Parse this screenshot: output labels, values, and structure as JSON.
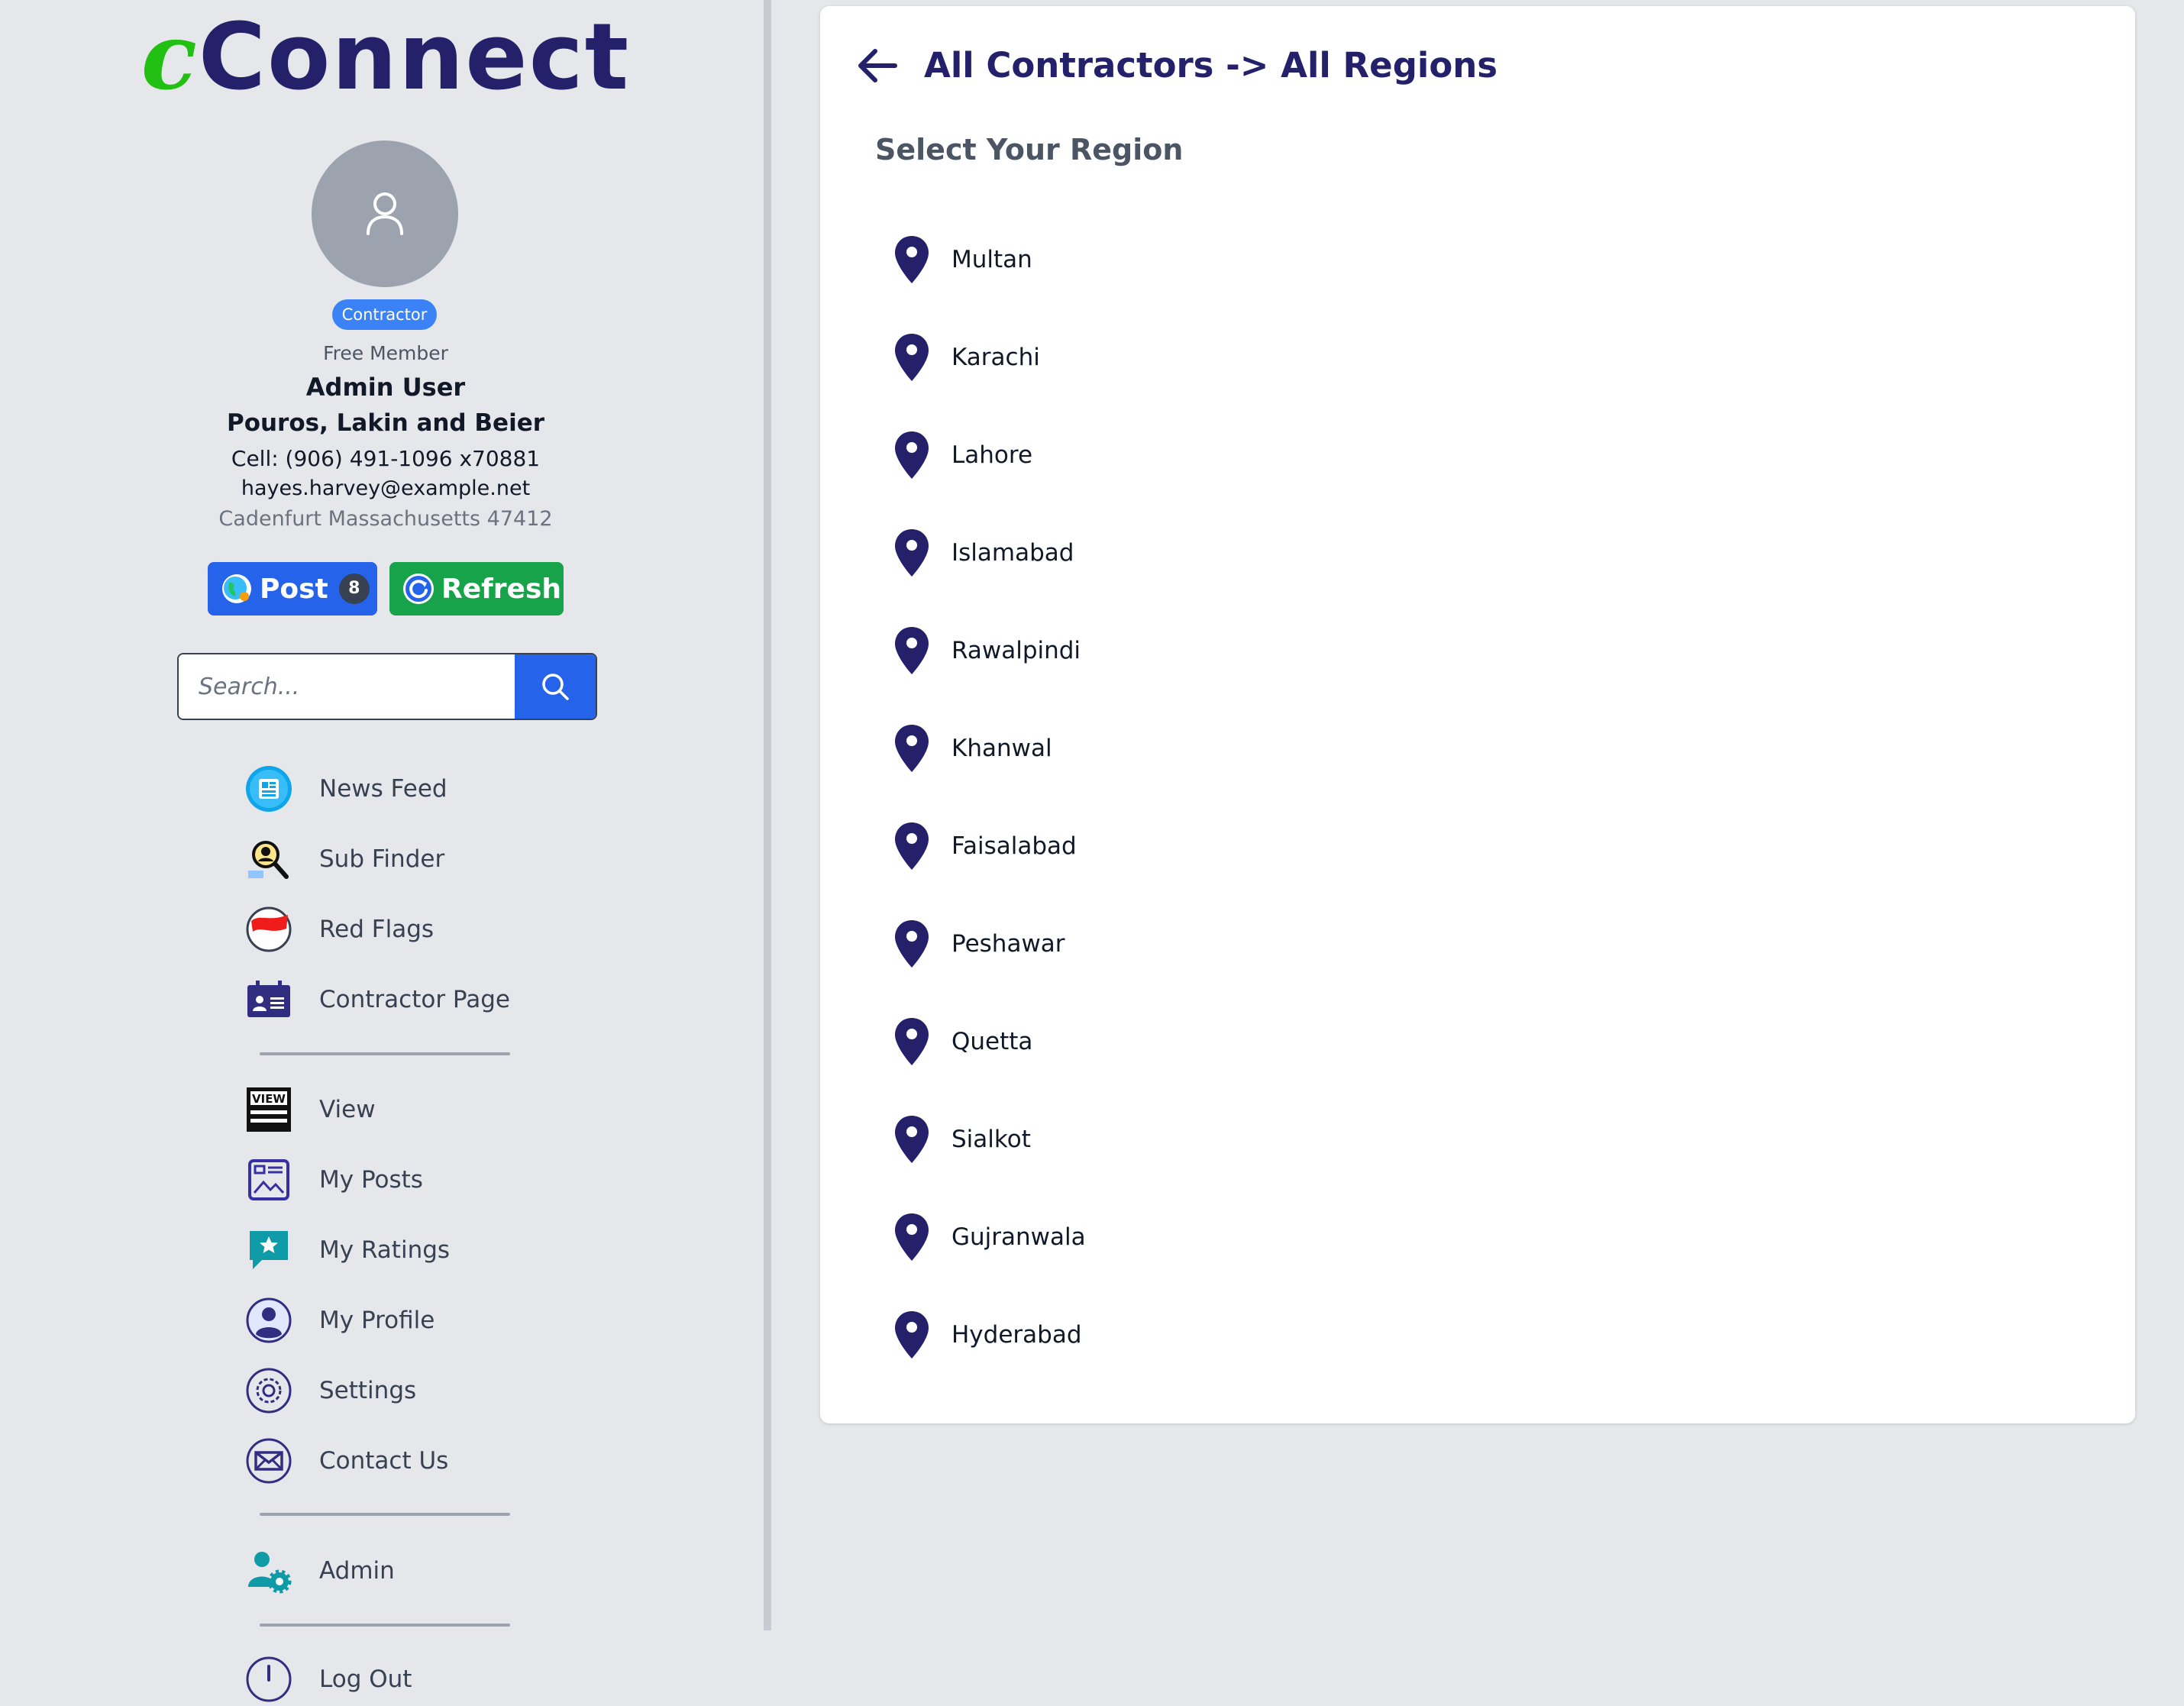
{
  "sidebar": {
    "logo": {
      "prefix": "c",
      "name": "Connect"
    },
    "profile": {
      "role": "Contractor",
      "membership": "Free Member",
      "name": "Admin User",
      "company": "Pouros, Lakin and Beier",
      "phone": "Cell: (906) 491-1096 x70881",
      "email": "hayes.harvey@example.net",
      "address": "Cadenfurt Massachusetts 47412"
    },
    "actions": {
      "post_label": "Post",
      "post_count": "8",
      "refresh_label": "Refresh"
    },
    "search": {
      "placeholder": "Search..."
    },
    "nav_primary": [
      {
        "label": "News Feed",
        "icon": "newspaper-icon"
      },
      {
        "label": "Sub Finder",
        "icon": "magnifier-person-icon"
      },
      {
        "label": "Red Flags",
        "icon": "red-flag-icon"
      },
      {
        "label": "Contractor Page",
        "icon": "id-card-icon"
      }
    ],
    "nav_secondary": [
      {
        "label": "View",
        "icon": "view-icon"
      },
      {
        "label": "My Posts",
        "icon": "posts-icon"
      },
      {
        "label": "My Ratings",
        "icon": "rating-star-icon"
      },
      {
        "label": "My Profile",
        "icon": "profile-icon"
      },
      {
        "label": "Settings",
        "icon": "gear-icon"
      },
      {
        "label": "Contact Us",
        "icon": "envelope-icon"
      }
    ],
    "nav_admin": [
      {
        "label": "Admin",
        "icon": "admin-gear-icon"
      }
    ],
    "nav_footer": [
      {
        "label": "Log Out",
        "icon": "power-icon"
      }
    ]
  },
  "main": {
    "breadcrumb": "All Contractors -> All Regions",
    "heading": "Select Your Region",
    "regions": [
      "Multan",
      "Karachi",
      "Lahore",
      "Islamabad",
      "Rawalpindi",
      "Khanwal",
      "Faisalabad",
      "Peshawar",
      "Quetta",
      "Sialkot",
      "Gujranwala",
      "Hyderabad"
    ]
  },
  "colors": {
    "brand_navy": "#24216a",
    "brand_green": "#22c012",
    "primary_blue": "#2563eb",
    "refresh_green": "#16a34a",
    "role_badge": "#3b82f6",
    "page_bg": "#e5e7eb"
  }
}
